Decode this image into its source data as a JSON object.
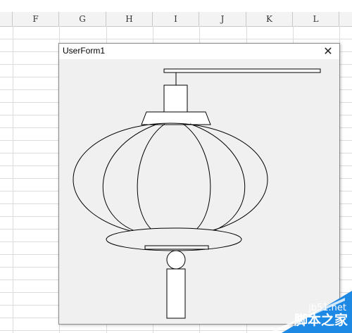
{
  "sheet": {
    "columns": [
      "F",
      "G",
      "H",
      "I",
      "J",
      "K",
      "L"
    ]
  },
  "userform": {
    "title": "UserForm1",
    "close_glyph": "✕",
    "drawing": "lantern"
  },
  "watermark": {
    "site": "jb51.net",
    "brand": "脚本之家",
    "color": "#1e88e5"
  }
}
